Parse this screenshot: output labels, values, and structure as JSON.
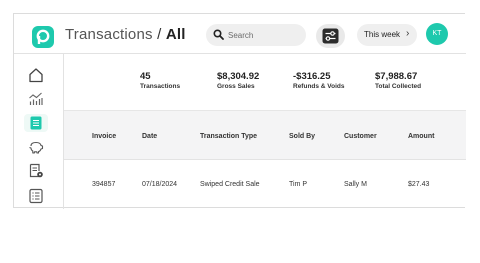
{
  "header": {
    "title_section": "Transactions",
    "title_separator": "/",
    "title_filter": "All",
    "search_placeholder": "Search",
    "date_range": "This week",
    "user_initials": "KT"
  },
  "sidebar": {
    "items": [
      {
        "icon": "home-icon",
        "active": false
      },
      {
        "icon": "chart-icon",
        "active": false
      },
      {
        "icon": "transactions-icon",
        "active": true
      },
      {
        "icon": "piggy-bank-icon",
        "active": false
      },
      {
        "icon": "invoice-settings-icon",
        "active": false
      },
      {
        "icon": "report-list-icon",
        "active": false
      }
    ]
  },
  "stats": [
    {
      "value": "45",
      "label": "Transactions"
    },
    {
      "value": "$8,304.92",
      "label": "Gross Sales"
    },
    {
      "value": "-$316.25",
      "label": "Refunds & Voids"
    },
    {
      "value": "$7,988.67",
      "label": "Total Collected"
    }
  ],
  "table": {
    "columns": [
      "Invoice",
      "Date",
      "Transaction Type",
      "Sold By",
      "Customer",
      "Amount"
    ],
    "rows": [
      [
        "394857",
        "07/18/2024",
        "Swiped Credit Sale",
        "Tim P",
        "Sally M",
        "$27.43"
      ]
    ]
  },
  "colors": {
    "accent": "#1ec9ad",
    "header_bg": "#f4f4f5"
  }
}
